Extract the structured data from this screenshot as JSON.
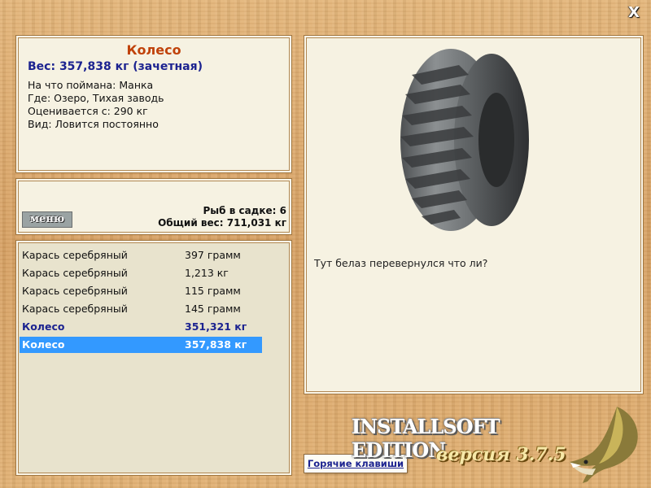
{
  "catch": {
    "title": "Колесо",
    "weight": "Вес: 357,838 кг (зачетная)",
    "bait": "На что поймана: Манка",
    "location": "Где: Озеро, Тихая заводь",
    "valued": "Оценивается с: 290 кг",
    "kind": "Вид: Ловится постоянно",
    "comment": "Тут белаз перевернулся что ли?"
  },
  "menu_label": "меню",
  "stats": {
    "keepnet": "Рыб в садке: 6",
    "total": "Общий вес: 711,031 кг"
  },
  "list": [
    {
      "name": "Карась серебряный",
      "weight": "397 грамм"
    },
    {
      "name": "Карась серебряный",
      "weight": "1,213 кг"
    },
    {
      "name": "Карась серебряный",
      "weight": "115 грамм"
    },
    {
      "name": "Карась серебряный",
      "weight": "145 грамм"
    },
    {
      "name": "Колесо",
      "weight": "351,321 кг"
    },
    {
      "name": "Колесо",
      "weight": "357,838 кг"
    }
  ],
  "hotkeys_label": "Горячие клавиши",
  "brand": "INSTALLSOFT EDITION",
  "version": "версия 3.7.5",
  "close_label": "X",
  "colors": {
    "title": "#c0420a",
    "accent_blue": "#1c2390",
    "selection": "#3399ff",
    "panel_bg": "#f6f2e2"
  },
  "icons": [
    "close-icon",
    "tire-image",
    "pike-logo-icon"
  ]
}
